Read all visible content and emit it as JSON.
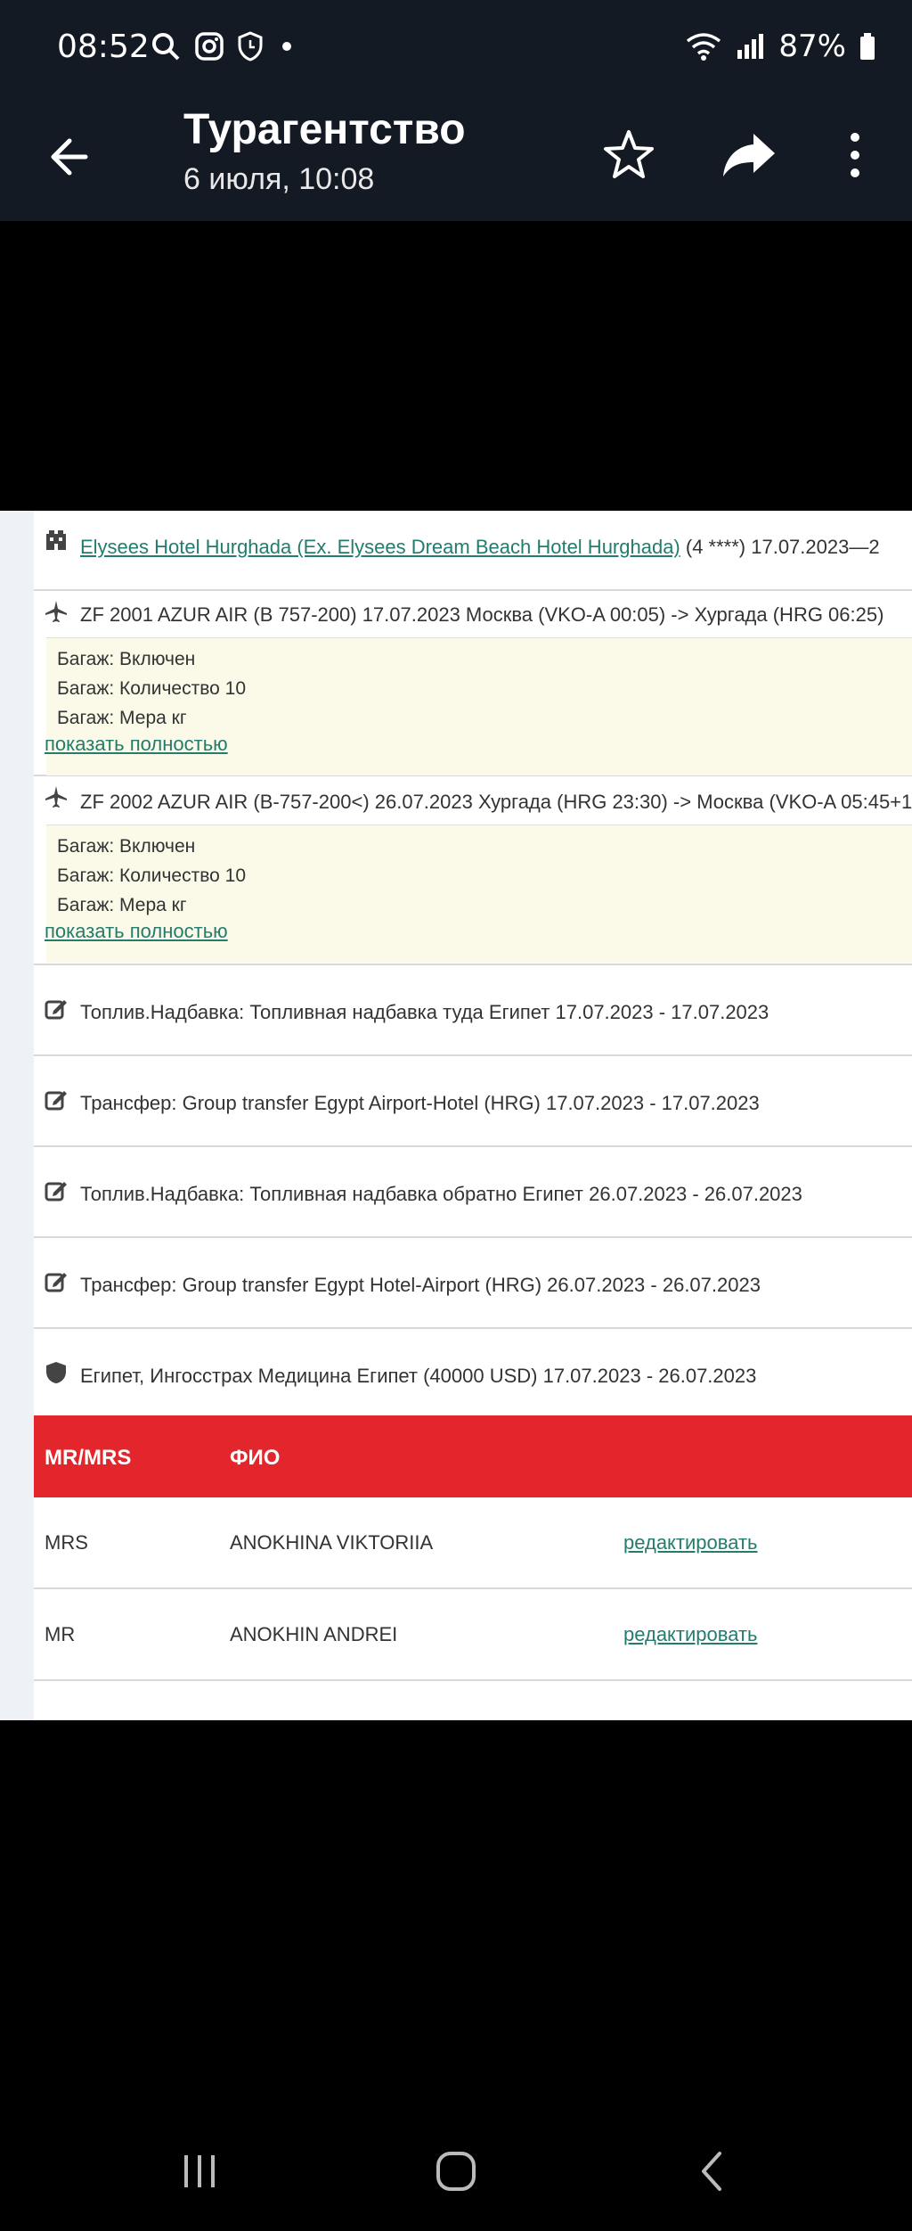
{
  "status": {
    "time": "08:52",
    "battery": "87%"
  },
  "appbar": {
    "title": "Турагентство",
    "subtitle": "6 июля, 10:08"
  },
  "document": {
    "hotel": {
      "name": "Elysees Hotel Hurghada (Ex. Elysees Dream Beach Hotel Hurghada)",
      "details": " (4 ****) 17.07.2023—2"
    },
    "flights": [
      {
        "text": "ZF 2001 AZUR AIR (B 757-200) 17.07.2023 Москва (VKO-A 00:05) -> Хургада (HRG 06:25)",
        "baggage": [
          "Багаж: Включен",
          "Багаж: Количество 10",
          "Багаж: Мера кг"
        ],
        "show_more": "показать полностью"
      },
      {
        "text": "ZF 2002 AZUR AIR (B-757-200<) 26.07.2023 Хургада (HRG 23:30) -> Москва (VKO-A 05:45+1",
        "baggage": [
          "Багаж: Включен",
          "Багаж: Количество 10",
          "Багаж: Мера кг"
        ],
        "show_more": "показать полностью"
      }
    ],
    "services": [
      "Топлив.Надбавка: Топливная надбавка туда Египет 17.07.2023 - 17.07.2023",
      "Трансфер: Group transfer Egypt Airport-Hotel (HRG) 17.07.2023 - 17.07.2023",
      "Топлив.Надбавка: Топливная надбавка обратно Египет 26.07.2023 - 26.07.2023",
      "Трансфер: Group transfer Egypt Hotel-Airport (HRG) 26.07.2023 - 26.07.2023"
    ],
    "insurance": "Египет, Ингосстрах Медицина Египет (40000 USD) 17.07.2023 - 26.07.2023",
    "tourists_table": {
      "headers": [
        "MR/MRS",
        "ФИО"
      ],
      "rows": [
        {
          "title": "MRS",
          "name": "ANOKHINA VIKTORIIA",
          "action": "редактировать"
        },
        {
          "title": "MR",
          "name": "ANOKHIN ANDREI",
          "action": "редактировать"
        }
      ]
    }
  }
}
